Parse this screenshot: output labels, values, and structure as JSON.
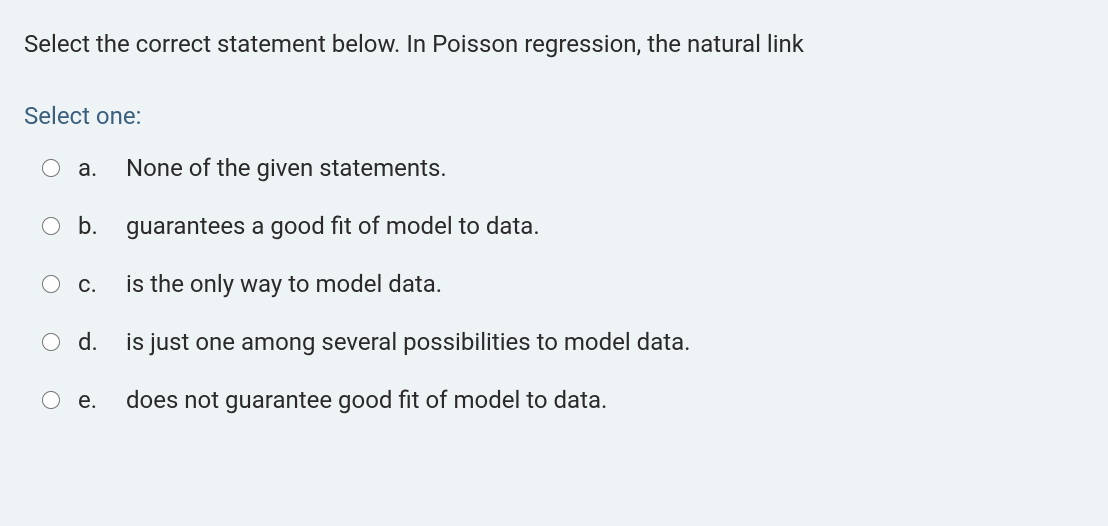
{
  "question": {
    "text": "Select the correct statement below. In Poisson regression, the natural link",
    "prompt": "Select one:",
    "options": [
      {
        "letter": "a.",
        "text": "None of the given statements."
      },
      {
        "letter": "b.",
        "text": "guarantees a good fit of model to data."
      },
      {
        "letter": "c.",
        "text": "is the only way to model data."
      },
      {
        "letter": "d.",
        "text": "is just one among several possibilities to model data."
      },
      {
        "letter": "e.",
        "text": "does not guarantee good fit of model to data."
      }
    ]
  }
}
